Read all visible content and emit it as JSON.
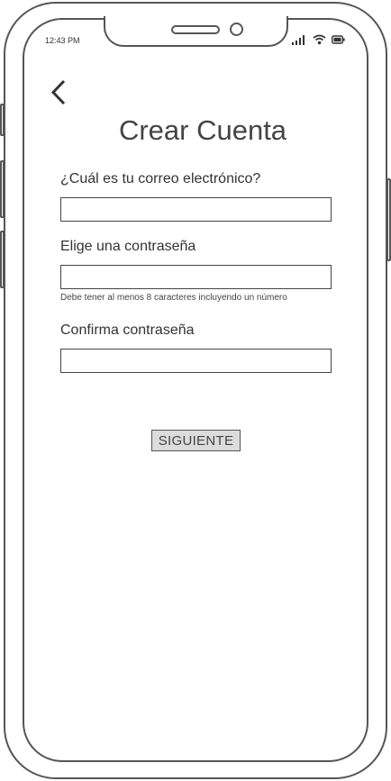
{
  "status_bar": {
    "time": "12:43 PM"
  },
  "nav": {
    "back_icon": "chevron-left-icon"
  },
  "page": {
    "title": "Crear Cuenta"
  },
  "form": {
    "email": {
      "label": "¿Cuál es tu correo electrónico?",
      "value": "",
      "placeholder": ""
    },
    "password": {
      "label": "Elige una contraseña",
      "value": "",
      "placeholder": "",
      "hint": "Debe tener al menos 8 caracteres incluyendo un número"
    },
    "confirm": {
      "label": "Confirma contraseña",
      "value": "",
      "placeholder": ""
    },
    "submit_label": "SIGUIENTE"
  },
  "colors": {
    "outline": "#555555",
    "button_bg": "#dcdcdc"
  }
}
